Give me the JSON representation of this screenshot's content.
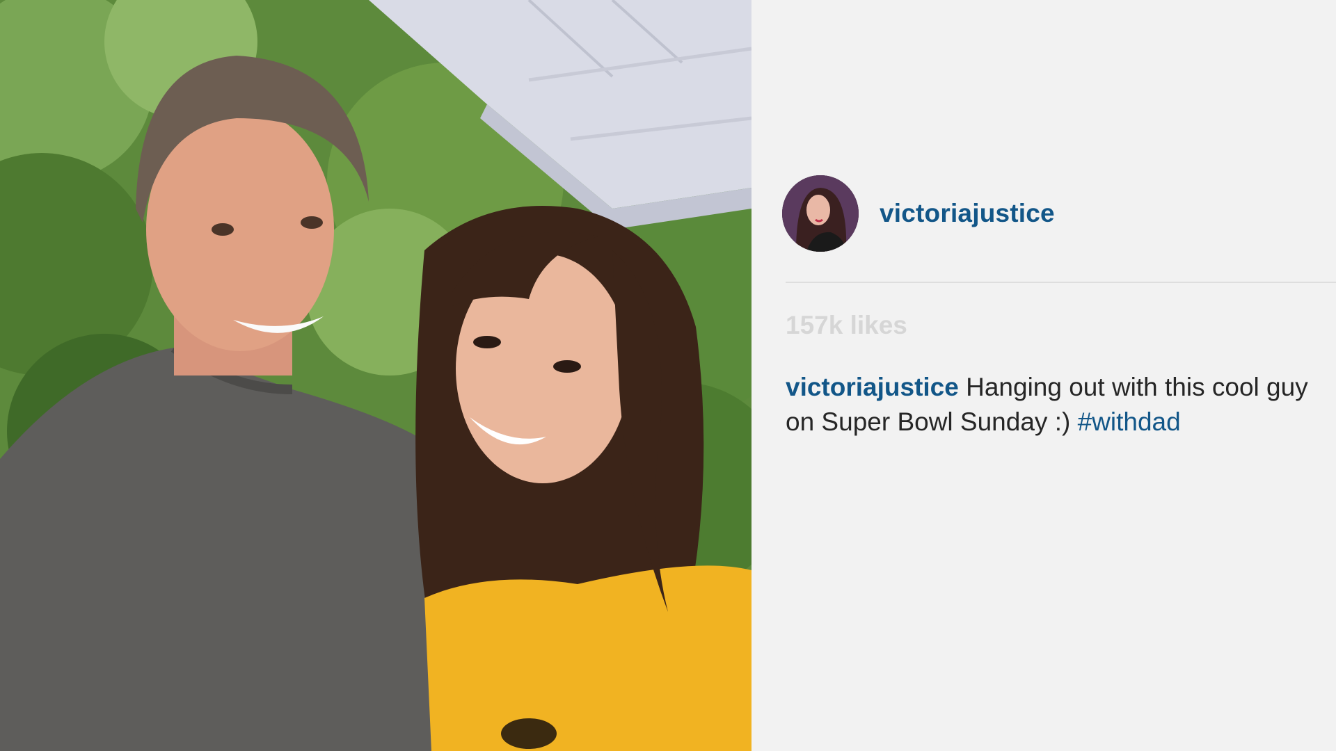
{
  "post": {
    "username": "victoriajustice",
    "likes": "157k likes",
    "caption": {
      "username": "victoriajustice",
      "text": "Hanging out with this cool guy on Super Bowl Sunday :)",
      "hashtag": "#withdad"
    }
  },
  "colors": {
    "link_blue": "#125688",
    "text": "#262626",
    "muted": "#d6d6d6",
    "panel_bg": "#f2f2f2"
  }
}
